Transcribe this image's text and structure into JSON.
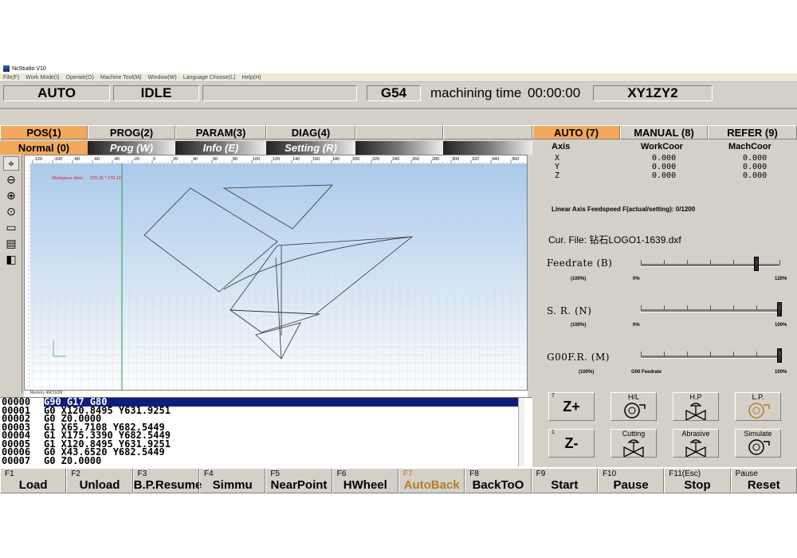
{
  "window": {
    "title": "NcStudio V10"
  },
  "menu": [
    "File(F)",
    "Work Mode(I)",
    "Operate(O)",
    "Machine Tool(M)",
    "Window(W)",
    "Language Choose(L)",
    "Help(H)"
  ],
  "status": {
    "mode": "AUTO",
    "state": "IDLE",
    "coord_system": "G54",
    "machining_time_label": "machining time",
    "machining_time": "00:00:00",
    "axes_label": "XY1ZY2"
  },
  "tabs": [
    "POS(1)",
    "PROG(2)",
    "PARAM(3)",
    "DIAG(4)"
  ],
  "subtabs": [
    "Normal (0)",
    "Prog (W)",
    "Info (E)",
    "Setting (R)"
  ],
  "view": {
    "workpiece_label": "Workpiece dims",
    "workpiece_size": "270.26 * 176.12",
    "ruler_ticks": [
      "-120",
      "-100",
      "-80",
      "-60",
      "-40",
      "-20",
      "0",
      "20",
      "40",
      "60",
      "80",
      "100",
      "120",
      "140",
      "160",
      "180",
      "200",
      "220",
      "240",
      "260",
      "280",
      "300",
      "320",
      "340",
      "360"
    ],
    "memory": "Memory 4M/192M"
  },
  "program": {
    "lines": [
      {
        "n": "00000",
        "code": "G90 G17 G80"
      },
      {
        "n": "00001",
        "code": "G0 X120.8495 Y631.9251"
      },
      {
        "n": "00002",
        "code": "G0 Z0.0000"
      },
      {
        "n": "00003",
        "code": "G1 X65.7108 Y682.5449"
      },
      {
        "n": "00004",
        "code": "G1 X175.3390 Y682.5449"
      },
      {
        "n": "00005",
        "code": "G1 X120.8495 Y631.9251"
      },
      {
        "n": "00006",
        "code": "G0 X43.6520 Y682.5449"
      },
      {
        "n": "00007",
        "code": "G0 Z0.0000"
      }
    ]
  },
  "right": {
    "tabs": [
      "AUTO (7)",
      "MANUAL (8)",
      "REFER (9)"
    ],
    "coord_header": {
      "axis": "Axis",
      "work": "WorkCoor",
      "mach": "MachCoor"
    },
    "coords": [
      {
        "axis": "X",
        "work": "0.000",
        "mach": "0.000"
      },
      {
        "axis": "Y",
        "work": "0.000",
        "mach": "0.000"
      },
      {
        "axis": "Z",
        "work": "0.000",
        "mach": "0.000"
      }
    ],
    "feedspeed": "Linear Axis Feedspeed F(actual/setting):  0/1200",
    "cur_file": "Cur. File: 钻石LOGO1-1639.dxf",
    "sliders": [
      {
        "label": "Feedrate (B)",
        "value_label": "(100%)",
        "min": "0%",
        "max": "120%",
        "level": 0.83
      },
      {
        "label": "S. R. (N)",
        "value_label": "(100%)",
        "min": "0%",
        "max": "100%",
        "level": 1.0
      },
      {
        "label": "G00F.R. (M)",
        "value_label": "(100%)",
        "min": "G00 Feedrate",
        "max": "100%",
        "level": 1.0
      }
    ],
    "jog": [
      {
        "num": "7",
        "label": "Z+"
      },
      {
        "num": "1",
        "label": "Z-"
      }
    ],
    "io_buttons": [
      "H/L",
      "H.P",
      "L.P.",
      "Cutting",
      "Abrasive",
      "Simulate"
    ]
  },
  "fkeys": [
    {
      "key": "F1",
      "label": "Load"
    },
    {
      "key": "F2",
      "label": "Unload"
    },
    {
      "key": "F3",
      "label": "B.P.Resume"
    },
    {
      "key": "F4",
      "label": "Simmu"
    },
    {
      "key": "F5",
      "label": "NearPoint"
    },
    {
      "key": "F6",
      "label": "HWheel"
    },
    {
      "key": "F7",
      "label": "AutoBack"
    },
    {
      "key": "F8",
      "label": "BackToO"
    },
    {
      "key": "F9",
      "label": "Start"
    },
    {
      "key": "F10",
      "label": "Pause"
    },
    {
      "key": "F11(Esc)",
      "label": "Stop"
    },
    {
      "key": "Pause",
      "label": "Reset"
    }
  ]
}
